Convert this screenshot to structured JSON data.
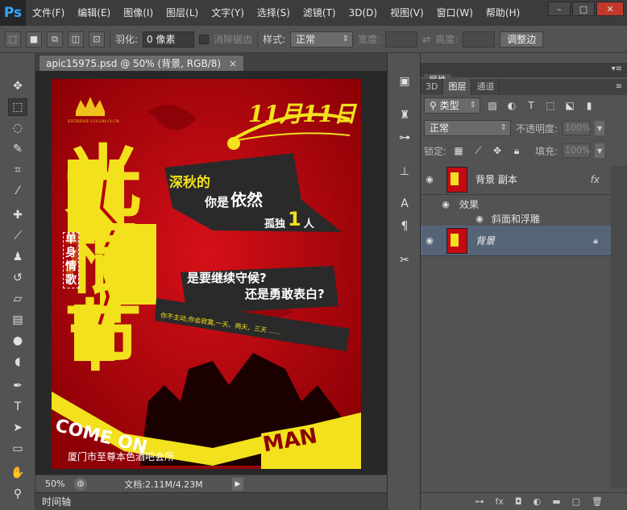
{
  "app": {
    "logo": "Ps"
  },
  "menu": [
    "文件(F)",
    "编辑(E)",
    "图像(I)",
    "图层(L)",
    "文字(Y)",
    "选择(S)",
    "滤镜(T)",
    "3D(D)",
    "视图(V)",
    "窗口(W)",
    "帮助(H)"
  ],
  "window_controls": {
    "minimize": "–",
    "maximize": "□",
    "close": "✕"
  },
  "options": {
    "feather_label": "羽化:",
    "feather_value": "0 像素",
    "antialias_label": "消除锯齿",
    "style_label": "样式:",
    "style_value": "正常",
    "width_label": "宽度:",
    "height_label": "高度:",
    "refine_button": "调整边"
  },
  "document": {
    "tab_title": "apic15975.psd @ 50% (背景, RGB/8)",
    "tab_close": "×",
    "zoom": "50%",
    "doc_info": "文档:2.11M/4.23M",
    "timeline_label": "时间轴"
  },
  "poster": {
    "date": "11月11日",
    "title": "光棍节",
    "vertical_tag": "单身情歌",
    "line1": "深秋的",
    "line2a": "你是",
    "line2b": "依然",
    "line2c": "孤独",
    "line2d": "1",
    "line2e": "人",
    "q1": "是要继续守候?",
    "q2": "还是勇敢表白?",
    "small": "你不主动,你会寂寞,一天、两天、三天 ......",
    "come_on": "COME ON",
    "man": "MAN",
    "venue": "厦门市至尊本色酒吧会所",
    "logo_caption": "EXTREME COLOR CLUB",
    "colors": {
      "bg": "#b50008",
      "yellow": "#f2e11c",
      "dark": "#2a2a2a"
    }
  },
  "panel": {
    "properties_tab": "属性",
    "tabs": [
      "3D",
      "图层",
      "通道"
    ],
    "filter_kind": "类型",
    "blend_mode": "正常",
    "opacity_label": "不透明度:",
    "opacity_value": "100%",
    "lock_label": "锁定:",
    "fill_label": "填充:",
    "fill_value": "100%",
    "layers": [
      {
        "name": "背景 副本",
        "fx": "fx"
      },
      {
        "name": "背景",
        "locked": true
      }
    ],
    "effects_label": "效果",
    "bevel_label": "斜面和浮雕"
  }
}
